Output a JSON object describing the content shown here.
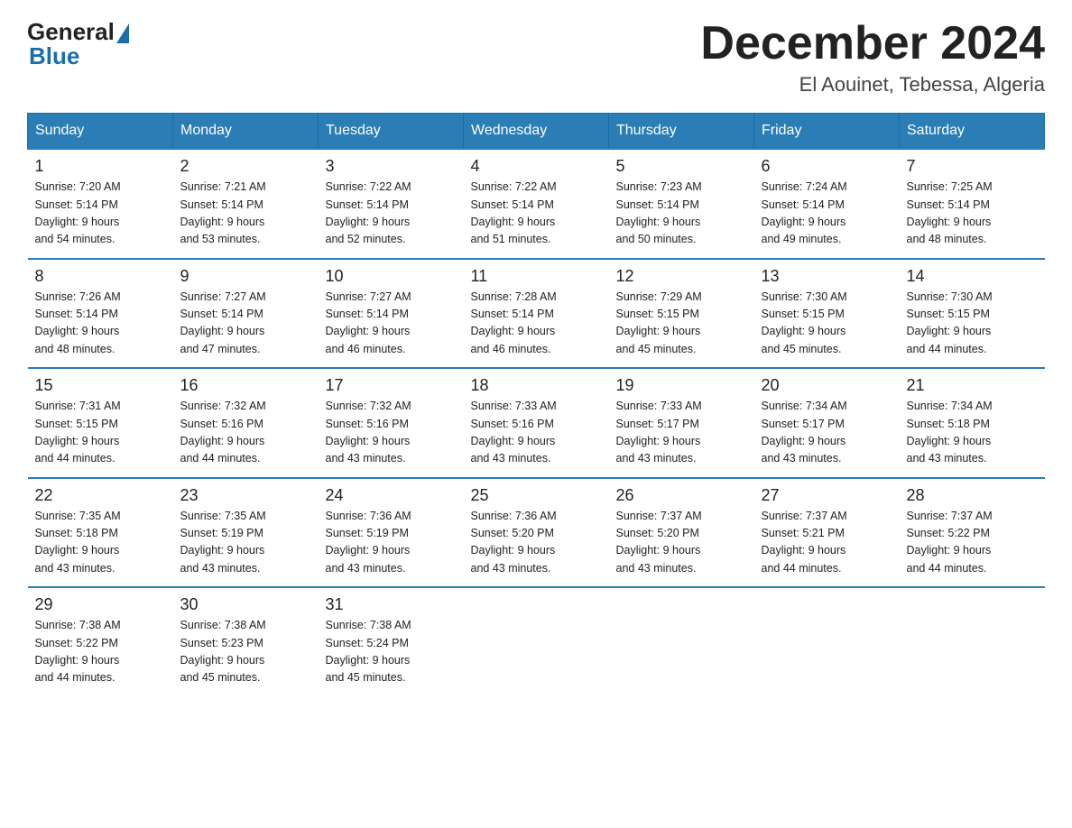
{
  "logo": {
    "general": "General",
    "blue": "Blue"
  },
  "header": {
    "month": "December 2024",
    "location": "El Aouinet, Tebessa, Algeria"
  },
  "days_of_week": [
    "Sunday",
    "Monday",
    "Tuesday",
    "Wednesday",
    "Thursday",
    "Friday",
    "Saturday"
  ],
  "weeks": [
    [
      {
        "day": "1",
        "sunrise": "7:20 AM",
        "sunset": "5:14 PM",
        "daylight": "9 hours and 54 minutes."
      },
      {
        "day": "2",
        "sunrise": "7:21 AM",
        "sunset": "5:14 PM",
        "daylight": "9 hours and 53 minutes."
      },
      {
        "day": "3",
        "sunrise": "7:22 AM",
        "sunset": "5:14 PM",
        "daylight": "9 hours and 52 minutes."
      },
      {
        "day": "4",
        "sunrise": "7:22 AM",
        "sunset": "5:14 PM",
        "daylight": "9 hours and 51 minutes."
      },
      {
        "day": "5",
        "sunrise": "7:23 AM",
        "sunset": "5:14 PM",
        "daylight": "9 hours and 50 minutes."
      },
      {
        "day": "6",
        "sunrise": "7:24 AM",
        "sunset": "5:14 PM",
        "daylight": "9 hours and 49 minutes."
      },
      {
        "day": "7",
        "sunrise": "7:25 AM",
        "sunset": "5:14 PM",
        "daylight": "9 hours and 48 minutes."
      }
    ],
    [
      {
        "day": "8",
        "sunrise": "7:26 AM",
        "sunset": "5:14 PM",
        "daylight": "9 hours and 48 minutes."
      },
      {
        "day": "9",
        "sunrise": "7:27 AM",
        "sunset": "5:14 PM",
        "daylight": "9 hours and 47 minutes."
      },
      {
        "day": "10",
        "sunrise": "7:27 AM",
        "sunset": "5:14 PM",
        "daylight": "9 hours and 46 minutes."
      },
      {
        "day": "11",
        "sunrise": "7:28 AM",
        "sunset": "5:14 PM",
        "daylight": "9 hours and 46 minutes."
      },
      {
        "day": "12",
        "sunrise": "7:29 AM",
        "sunset": "5:15 PM",
        "daylight": "9 hours and 45 minutes."
      },
      {
        "day": "13",
        "sunrise": "7:30 AM",
        "sunset": "5:15 PM",
        "daylight": "9 hours and 45 minutes."
      },
      {
        "day": "14",
        "sunrise": "7:30 AM",
        "sunset": "5:15 PM",
        "daylight": "9 hours and 44 minutes."
      }
    ],
    [
      {
        "day": "15",
        "sunrise": "7:31 AM",
        "sunset": "5:15 PM",
        "daylight": "9 hours and 44 minutes."
      },
      {
        "day": "16",
        "sunrise": "7:32 AM",
        "sunset": "5:16 PM",
        "daylight": "9 hours and 44 minutes."
      },
      {
        "day": "17",
        "sunrise": "7:32 AM",
        "sunset": "5:16 PM",
        "daylight": "9 hours and 43 minutes."
      },
      {
        "day": "18",
        "sunrise": "7:33 AM",
        "sunset": "5:16 PM",
        "daylight": "9 hours and 43 minutes."
      },
      {
        "day": "19",
        "sunrise": "7:33 AM",
        "sunset": "5:17 PM",
        "daylight": "9 hours and 43 minutes."
      },
      {
        "day": "20",
        "sunrise": "7:34 AM",
        "sunset": "5:17 PM",
        "daylight": "9 hours and 43 minutes."
      },
      {
        "day": "21",
        "sunrise": "7:34 AM",
        "sunset": "5:18 PM",
        "daylight": "9 hours and 43 minutes."
      }
    ],
    [
      {
        "day": "22",
        "sunrise": "7:35 AM",
        "sunset": "5:18 PM",
        "daylight": "9 hours and 43 minutes."
      },
      {
        "day": "23",
        "sunrise": "7:35 AM",
        "sunset": "5:19 PM",
        "daylight": "9 hours and 43 minutes."
      },
      {
        "day": "24",
        "sunrise": "7:36 AM",
        "sunset": "5:19 PM",
        "daylight": "9 hours and 43 minutes."
      },
      {
        "day": "25",
        "sunrise": "7:36 AM",
        "sunset": "5:20 PM",
        "daylight": "9 hours and 43 minutes."
      },
      {
        "day": "26",
        "sunrise": "7:37 AM",
        "sunset": "5:20 PM",
        "daylight": "9 hours and 43 minutes."
      },
      {
        "day": "27",
        "sunrise": "7:37 AM",
        "sunset": "5:21 PM",
        "daylight": "9 hours and 44 minutes."
      },
      {
        "day": "28",
        "sunrise": "7:37 AM",
        "sunset": "5:22 PM",
        "daylight": "9 hours and 44 minutes."
      }
    ],
    [
      {
        "day": "29",
        "sunrise": "7:38 AM",
        "sunset": "5:22 PM",
        "daylight": "9 hours and 44 minutes."
      },
      {
        "day": "30",
        "sunrise": "7:38 AM",
        "sunset": "5:23 PM",
        "daylight": "9 hours and 45 minutes."
      },
      {
        "day": "31",
        "sunrise": "7:38 AM",
        "sunset": "5:24 PM",
        "daylight": "9 hours and 45 minutes."
      },
      null,
      null,
      null,
      null
    ]
  ]
}
